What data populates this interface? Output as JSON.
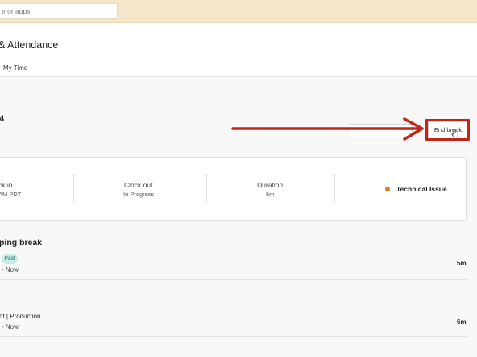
{
  "search": {
    "placeholder_fragment": "e or apps"
  },
  "header": {
    "title_fragment": "& Attendance",
    "tab_label": "My Time"
  },
  "timecard": {
    "date_fragment": "4",
    "end_break_label": "End break",
    "clock_in": {
      "label_fragment": "ck in",
      "value_fragment": "AM PDT"
    },
    "clock_out": {
      "label": "Clock out",
      "value": "In Progress"
    },
    "duration": {
      "label": "Duration",
      "value": "6m"
    },
    "status": {
      "text": "Technical Issue",
      "dot_color": "#e07a2a"
    }
  },
  "breaks": {
    "title_fragment": "ping break",
    "rows": [
      {
        "badge": "Paid",
        "time_fragment": "- Now",
        "duration": "5m"
      },
      {
        "title_fragment": "nt | Production",
        "time_fragment": "- Now",
        "duration": "6m"
      }
    ]
  },
  "annotation": {
    "color": "#c0251a"
  }
}
